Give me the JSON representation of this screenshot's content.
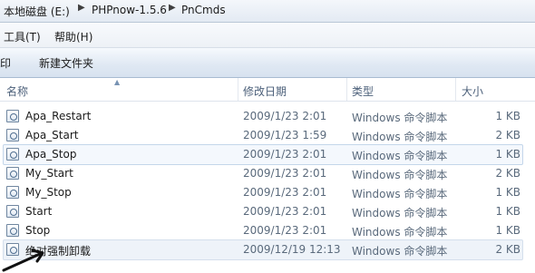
{
  "address": {
    "crumbs": [
      "本地磁盘 (E:)",
      "PHPnow-1.5.6",
      "PnCmds"
    ]
  },
  "menu": {
    "tools": "工具(T)",
    "help": "帮助(H)"
  },
  "toolbar": {
    "print": "印",
    "new_folder": "新建文件夹"
  },
  "columns": {
    "name": "名称",
    "modified": "修改日期",
    "type": "类型",
    "size": "大小"
  },
  "files": [
    {
      "name": "Apa_Restart",
      "modified": "2009/1/23 2:01",
      "type": "Windows 命令脚本",
      "size": "1 KB"
    },
    {
      "name": "Apa_Start",
      "modified": "2009/1/23 1:59",
      "type": "Windows 命令脚本",
      "size": "2 KB"
    },
    {
      "name": "Apa_Stop",
      "modified": "2009/1/23 2:01",
      "type": "Windows 命令脚本",
      "size": "1 KB"
    },
    {
      "name": "My_Start",
      "modified": "2009/1/23 2:01",
      "type": "Windows 命令脚本",
      "size": "2 KB"
    },
    {
      "name": "My_Stop",
      "modified": "2009/1/23 2:01",
      "type": "Windows 命令脚本",
      "size": "1 KB"
    },
    {
      "name": "Start",
      "modified": "2009/1/23 2:01",
      "type": "Windows 命令脚本",
      "size": "1 KB"
    },
    {
      "name": "Stop",
      "modified": "2009/1/23 2:01",
      "type": "Windows 命令脚本",
      "size": "1 KB"
    },
    {
      "name": "绝对强制卸载",
      "modified": "2009/12/19 12:13",
      "type": "Windows 命令脚本",
      "size": "2 KB"
    }
  ],
  "colors": {
    "selection_border": "#c4d6ea",
    "header_text": "#4c607a",
    "arrow": "#111111"
  },
  "icons": {
    "file": "script-file-icon",
    "annotation": "arrow-pointer"
  }
}
